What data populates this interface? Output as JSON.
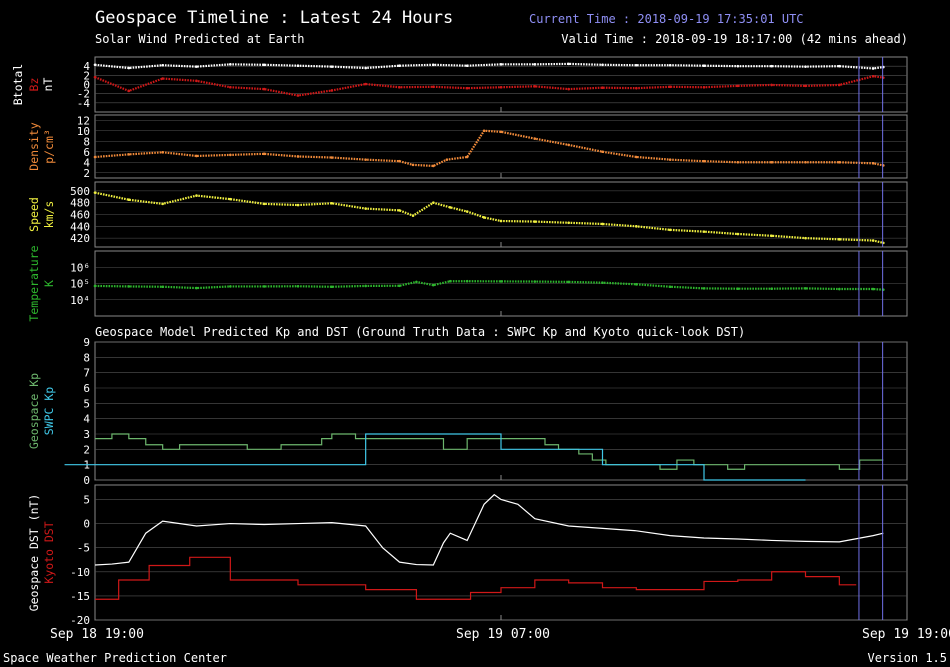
{
  "header": {
    "title": "Geospace Timeline : Latest 24 Hours",
    "current_time": "Current Time : 2018-09-19 17:35:01 UTC",
    "subtitle": "Solar Wind Predicted at Earth",
    "valid_time": "Valid Time : 2018-09-19 18:17:00 (42 mins ahead)",
    "section2_title": "Geospace Model Predicted Kp and DST (Ground Truth Data : SWPC Kp and Kyoto quick-look DST)"
  },
  "footer": {
    "left": "Space Weather Prediction Center",
    "right": "Version 1.5"
  },
  "colors": {
    "white": "#ffffff",
    "red": "#d01818",
    "orange": "#f08a3a",
    "yellow": "#f0f040",
    "green": "#2db62d",
    "kp_green": "#6db66d",
    "cyan": "#40c8e8",
    "marker": "#7070e8",
    "grid": "#555555"
  },
  "chart_data": [
    {
      "type": "line",
      "ylabels": [
        {
          "text": "Btotal",
          "color": "#ffffff"
        },
        {
          "text": "Bz",
          "color": "#d01818"
        },
        {
          "text": "nT",
          "color": "#ffffff"
        }
      ],
      "ylim": [
        -6,
        6
      ],
      "yticks": [
        {
          "v": 4,
          "label": "4"
        },
        {
          "v": 2,
          "label": "2"
        },
        {
          "v": 0,
          "label": "0"
        },
        {
          "v": -2,
          "label": "-2"
        },
        {
          "v": -4,
          "label": "-4"
        }
      ],
      "grid": true,
      "series": [
        {
          "color": "#ffffff",
          "style": "dots",
          "x": [
            0,
            1,
            2,
            3,
            4,
            5,
            6,
            7,
            8,
            9,
            10,
            11,
            12,
            13,
            14,
            15,
            16,
            17,
            18,
            19,
            20,
            21,
            22,
            23,
            23.3
          ],
          "y": [
            4.3,
            3.6,
            4.2,
            3.9,
            4.4,
            4.3,
            4.1,
            3.9,
            3.6,
            4.1,
            4.3,
            4.1,
            4.4,
            4.4,
            4.5,
            4.3,
            4.2,
            4.2,
            4.1,
            4.0,
            4.0,
            3.9,
            4.0,
            3.5,
            3.8
          ]
        },
        {
          "color": "#d01818",
          "style": "dots",
          "x": [
            0,
            1,
            2,
            3,
            4,
            5,
            6,
            7,
            8,
            9,
            10,
            11,
            12,
            13,
            14,
            15,
            16,
            17,
            18,
            19,
            20,
            21,
            22,
            23,
            23.3
          ],
          "y": [
            1.6,
            -1.4,
            1.3,
            0.8,
            -0.6,
            -1.0,
            -2.4,
            -1.3,
            0.1,
            -0.6,
            -0.5,
            -0.8,
            -0.6,
            -0.4,
            -1.0,
            -0.7,
            -0.8,
            -0.5,
            -0.6,
            -0.3,
            -0.1,
            -0.3,
            -0.1,
            1.8,
            1.5
          ]
        }
      ]
    },
    {
      "type": "scatter",
      "ylabels": [
        {
          "text": "Density",
          "color": "#f08a3a"
        },
        {
          "text": "p/cm³",
          "color": "#f08a3a"
        }
      ],
      "ylim": [
        1,
        13
      ],
      "yticks": [
        {
          "v": 12,
          "label": "12"
        },
        {
          "v": 10,
          "label": "10"
        },
        {
          "v": 8,
          "label": "8"
        },
        {
          "v": 6,
          "label": "6"
        },
        {
          "v": 4,
          "label": "4"
        },
        {
          "v": 2,
          "label": "2"
        }
      ],
      "grid": true,
      "series": [
        {
          "color": "#f08a3a",
          "style": "dots",
          "x": [
            0,
            1,
            2,
            3,
            4,
            5,
            6,
            7,
            8,
            9,
            9.4,
            10,
            10.4,
            11,
            11.5,
            12,
            13,
            14,
            15,
            16,
            17,
            18,
            19,
            20,
            21,
            22,
            23,
            23.3
          ],
          "y": [
            5.0,
            5.5,
            5.9,
            5.2,
            5.4,
            5.6,
            5.1,
            4.9,
            4.5,
            4.2,
            3.5,
            3.3,
            4.5,
            5.0,
            10.0,
            9.8,
            8.5,
            7.3,
            6.0,
            5.0,
            4.5,
            4.2,
            4.0,
            4.0,
            4.0,
            4.0,
            3.8,
            3.4
          ]
        }
      ]
    },
    {
      "type": "scatter",
      "ylabels": [
        {
          "text": "Speed",
          "color": "#f0f040"
        },
        {
          "text": "km/s",
          "color": "#f0f040"
        }
      ],
      "ylim": [
        405,
        515
      ],
      "yticks": [
        {
          "v": 500,
          "label": "500"
        },
        {
          "v": 480,
          "label": "480"
        },
        {
          "v": 460,
          "label": "460"
        },
        {
          "v": 440,
          "label": "440"
        },
        {
          "v": 420,
          "label": "420"
        }
      ],
      "grid": true,
      "series": [
        {
          "color": "#f0f040",
          "style": "dots",
          "x": [
            0,
            1,
            2,
            3,
            4,
            5,
            6,
            7,
            8,
            9,
            9.4,
            10,
            10.5,
            11,
            11.5,
            12,
            13,
            14,
            15,
            16,
            17,
            18,
            19,
            20,
            21,
            22,
            23,
            23.3
          ],
          "y": [
            497,
            485,
            478,
            492,
            486,
            478,
            476,
            479,
            470,
            467,
            458,
            480,
            472,
            465,
            455,
            449,
            448,
            446,
            444,
            440,
            434,
            431,
            427,
            424,
            420,
            418,
            416,
            412
          ]
        }
      ]
    },
    {
      "type": "scatter",
      "ylabels": [
        {
          "text": "Temperature",
          "color": "#2db62d"
        },
        {
          "text": "K",
          "color": "#2db62d"
        }
      ],
      "scale": "log",
      "ylim": [
        3,
        7
      ],
      "yticks": [
        {
          "v": 6,
          "label": "10⁶"
        },
        {
          "v": 5,
          "label": "10⁵"
        },
        {
          "v": 4,
          "label": "10⁴"
        }
      ],
      "grid": true,
      "series": [
        {
          "color": "#2db62d",
          "style": "dots",
          "x": [
            0,
            1,
            2,
            3,
            4,
            5,
            6,
            7,
            8,
            9,
            9.5,
            10,
            10.5,
            11,
            12,
            13,
            14,
            15,
            16,
            17,
            18,
            19,
            20,
            21,
            22,
            23,
            23.3
          ],
          "y": [
            4.85,
            4.82,
            4.8,
            4.72,
            4.82,
            4.82,
            4.83,
            4.8,
            4.85,
            4.86,
            5.1,
            4.9,
            5.14,
            5.14,
            5.13,
            5.12,
            5.1,
            5.05,
            4.95,
            4.8,
            4.7,
            4.68,
            4.68,
            4.7,
            4.66,
            4.66,
            4.62
          ]
        }
      ]
    },
    {
      "type": "line",
      "ylabels": [
        {
          "text": "Geospace Kp",
          "color": "#6db66d"
        },
        {
          "text": "SWPC Kp",
          "color": "#40c8e8"
        }
      ],
      "ylim": [
        0,
        9
      ],
      "yticks": [
        {
          "v": 9,
          "label": "9"
        },
        {
          "v": 8,
          "label": "8"
        },
        {
          "v": 7,
          "label": "7"
        },
        {
          "v": 6,
          "label": "6"
        },
        {
          "v": 5,
          "label": "5"
        },
        {
          "v": 4,
          "label": "4"
        },
        {
          "v": 3,
          "label": "3"
        },
        {
          "v": 2,
          "label": "2"
        },
        {
          "v": 1,
          "label": "1"
        },
        {
          "v": 0,
          "label": "0"
        }
      ],
      "grid": true,
      "series": [
        {
          "color": "#6db66d",
          "style": "step",
          "x": [
            0,
            0.5,
            1,
            1.5,
            2,
            2.5,
            4.5,
            5.5,
            6.7,
            7,
            7.7,
            8,
            10.3,
            11,
            13.3,
            13.7,
            14.3,
            14.7,
            15.1,
            16,
            16.7,
            17.2,
            17.7,
            18,
            18.7,
            19.2,
            20,
            21,
            22,
            22.6,
            23.3
          ],
          "y": [
            2.7,
            3.0,
            2.7,
            2.3,
            2.0,
            2.3,
            2.0,
            2.3,
            2.7,
            3.0,
            2.7,
            2.7,
            2.0,
            2.7,
            2.3,
            2.0,
            1.7,
            1.3,
            1.0,
            1.0,
            0.7,
            1.3,
            1.0,
            1.0,
            0.7,
            1.0,
            1.0,
            1.0,
            0.7,
            1.3,
            1.3
          ]
        },
        {
          "color": "#40c8e8",
          "style": "step",
          "x": [
            -0.9,
            8,
            12,
            15,
            18,
            21
          ],
          "y": [
            1,
            3,
            2,
            1,
            0,
            0
          ]
        }
      ]
    },
    {
      "type": "line",
      "ylabels": [
        {
          "text": "Geospace DST (nT)",
          "color": "#ffffff"
        },
        {
          "text": "Kyoto DST",
          "color": "#d01818"
        }
      ],
      "ylim": [
        -20,
        8
      ],
      "yticks": [
        {
          "v": 5,
          "label": "5"
        },
        {
          "v": 0,
          "label": "0"
        },
        {
          "v": -5,
          "label": "-5"
        },
        {
          "v": -10,
          "label": "-10"
        },
        {
          "v": -15,
          "label": "-15"
        },
        {
          "v": -20,
          "label": "-20"
        }
      ],
      "grid": true,
      "series": [
        {
          "color": "#ffffff",
          "style": "line",
          "x": [
            0,
            0.5,
            1,
            1.5,
            2,
            3,
            4,
            5,
            6,
            7,
            8,
            8.5,
            9,
            9.5,
            10,
            10.3,
            10.5,
            11,
            11.5,
            11.8,
            12,
            12.5,
            13,
            14,
            15,
            16,
            17,
            18,
            19,
            20,
            21,
            22,
            23,
            23.3
          ],
          "y": [
            -8.6,
            -8.4,
            -8.0,
            -2,
            0.5,
            -0.5,
            0,
            -0.2,
            0,
            0.2,
            -0.5,
            -5,
            -8,
            -8.5,
            -8.6,
            -4,
            -2,
            -3.5,
            4,
            6,
            5,
            4,
            1,
            -0.5,
            -1,
            -1.5,
            -2.5,
            -3,
            -3.2,
            -3.5,
            -3.7,
            -3.8,
            -2.5,
            -2.0
          ]
        },
        {
          "color": "#d01818",
          "style": "step",
          "x": [
            0,
            0.7,
            1.6,
            2.8,
            4.0,
            6,
            8,
            9.5,
            11.1,
            12,
            13,
            14,
            15,
            16,
            17,
            18,
            19,
            20,
            21,
            22,
            22.5
          ],
          "y": [
            -15.7,
            -11.7,
            -8.7,
            -7,
            -11.7,
            -12.7,
            -13.7,
            -15.7,
            -14.3,
            -13.3,
            -11.7,
            -12.3,
            -13.3,
            -13.7,
            -13.7,
            -12.0,
            -11.7,
            -10.0,
            -11.0,
            -12.7,
            -12.7
          ]
        }
      ]
    }
  ],
  "time_axis": {
    "range_hours": [
      0,
      24
    ],
    "ticks": [
      {
        "h": 0,
        "label": "Sep 18 19:00"
      },
      {
        "h": 12,
        "label": "Sep 19 07:00"
      },
      {
        "h": 24,
        "label": "Sep 19 19:00"
      }
    ],
    "markers": [
      {
        "h": 22.58,
        "kind": "current time",
        "color": "#7070e8"
      },
      {
        "h": 23.28,
        "kind": "valid time",
        "color": "#7070e8"
      }
    ]
  }
}
